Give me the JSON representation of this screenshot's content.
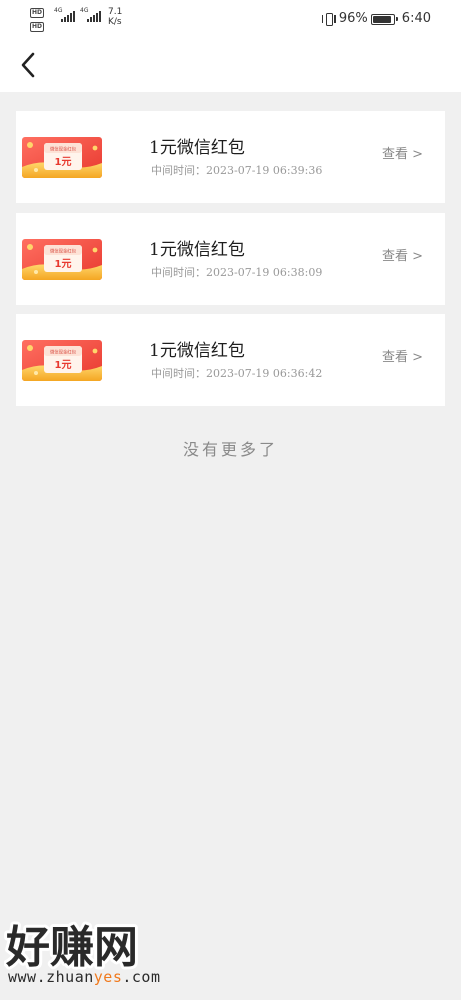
{
  "status_bar": {
    "hd_top": "HD",
    "hd_bottom": "HD",
    "net_top": "4G",
    "net_bottom": "4G",
    "speed_value": "7.1",
    "speed_unit": "K/s",
    "battery_percent": "96%",
    "time": "6:40",
    "battery_level": 0.96
  },
  "header": {
    "back_icon": "chevron-left-icon"
  },
  "records": [
    {
      "thumb_caption": "微信现金红包",
      "thumb_amount": "1元",
      "title": "1元微信红包",
      "time": "中间时间：2023-07-19 06:39:36",
      "action": "查看 >"
    },
    {
      "thumb_caption": "微信现金红包",
      "thumb_amount": "1元",
      "title": "1元微信红包",
      "time": "中间时间：2023-07-19 06:38:09",
      "action": "查看 >"
    },
    {
      "thumb_caption": "微信现金红包",
      "thumb_amount": "1元",
      "title": "1元微信红包",
      "time": "中间时间：2023-07-19 06:36:42",
      "action": "查看 >"
    }
  ],
  "footer": {
    "no_more_text": "没有更多了"
  },
  "watermark": {
    "brand": "好赚网",
    "url_part1": "www.zhuan",
    "url_part2": "yes",
    "url_part3": ".com"
  },
  "colors": {
    "background": "#f0f0f0",
    "card": "#ffffff",
    "thumb_red": "#f0473c",
    "thumb_gold": "#f7b733",
    "watermark_orange": "#f07a1e"
  }
}
